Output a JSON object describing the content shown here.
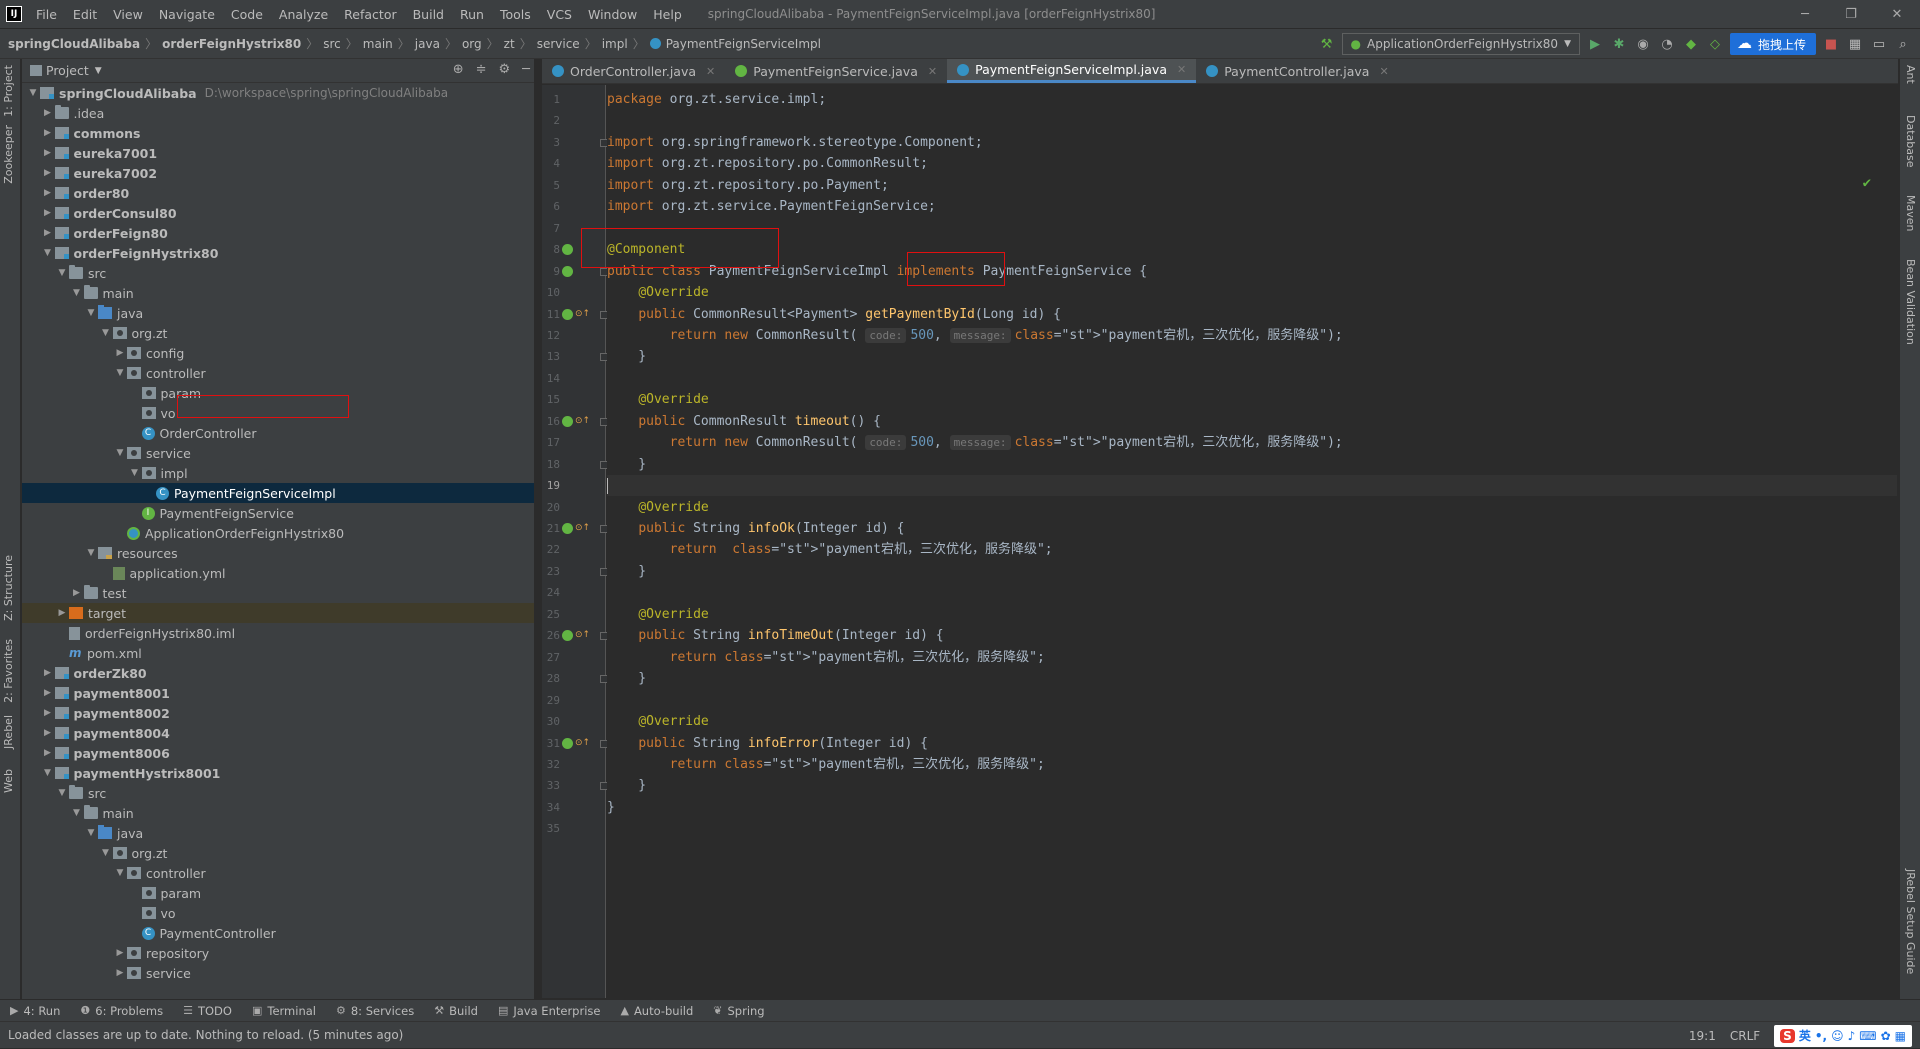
{
  "window": {
    "title": "springCloudAlibaba - PaymentFeignServiceImpl.java [orderFeignHystrix80]",
    "menu": [
      "File",
      "Edit",
      "View",
      "Navigate",
      "Code",
      "Analyze",
      "Refactor",
      "Build",
      "Run",
      "Tools",
      "VCS",
      "Window",
      "Help"
    ]
  },
  "breadcrumb": [
    "springCloudAlibaba",
    "orderFeignHystrix80",
    "src",
    "main",
    "java",
    "org",
    "zt",
    "service",
    "impl",
    "PaymentFeignServiceImpl"
  ],
  "toolbar": {
    "run_config": "ApplicationOrderFeignHystrix80",
    "upload_label": "拖拽上传"
  },
  "left_strip": {
    "project": "1: Project",
    "zookeeper": "Zookeeper",
    "structure": "Z: Structure",
    "favorites": "2: Favorites",
    "jrebel": "JRebel",
    "web": "Web"
  },
  "right_strip": {
    "ant": "Ant",
    "database": "Database",
    "maven": "Maven",
    "bean": "Bean Validation",
    "jrebel_guide": "JRebel Setup Guide"
  },
  "project_panel": {
    "title": "Project",
    "tree": [
      {
        "label": "springCloudAlibaba",
        "path": "D:\\workspace\\spring\\springCloudAlibaba",
        "icon": "mfolder",
        "depth": 0,
        "arrow": "v",
        "bold": true
      },
      {
        "label": ".idea",
        "icon": "folder",
        "depth": 1,
        "arrow": ">"
      },
      {
        "label": "commons",
        "icon": "mfolder",
        "depth": 1,
        "arrow": ">",
        "bold": true
      },
      {
        "label": "eureka7001",
        "icon": "mfolder",
        "depth": 1,
        "arrow": ">",
        "bold": true
      },
      {
        "label": "eureka7002",
        "icon": "mfolder",
        "depth": 1,
        "arrow": ">",
        "bold": true
      },
      {
        "label": "order80",
        "icon": "mfolder",
        "depth": 1,
        "arrow": ">",
        "bold": true
      },
      {
        "label": "orderConsul80",
        "icon": "mfolder",
        "depth": 1,
        "arrow": ">",
        "bold": true
      },
      {
        "label": "orderFeign80",
        "icon": "mfolder",
        "depth": 1,
        "arrow": ">",
        "bold": true
      },
      {
        "label": "orderFeignHystrix80",
        "icon": "mfolder",
        "depth": 1,
        "arrow": "v",
        "bold": true
      },
      {
        "label": "src",
        "icon": "folder",
        "depth": 2,
        "arrow": "v"
      },
      {
        "label": "main",
        "icon": "folder",
        "depth": 3,
        "arrow": "v"
      },
      {
        "label": "java",
        "icon": "src",
        "depth": 4,
        "arrow": "v"
      },
      {
        "label": "org.zt",
        "icon": "pkg",
        "depth": 5,
        "arrow": "v"
      },
      {
        "label": "config",
        "icon": "pkg",
        "depth": 6,
        "arrow": ">"
      },
      {
        "label": "controller",
        "icon": "pkg",
        "depth": 6,
        "arrow": "v"
      },
      {
        "label": "param",
        "icon": "pkg",
        "depth": 7,
        "arrow": ""
      },
      {
        "label": "vo",
        "icon": "pkg",
        "depth": 7,
        "arrow": ""
      },
      {
        "label": "OrderController",
        "icon": "class",
        "depth": 7,
        "arrow": ""
      },
      {
        "label": "service",
        "icon": "pkg",
        "depth": 6,
        "arrow": "v"
      },
      {
        "label": "impl",
        "icon": "pkg",
        "depth": 7,
        "arrow": "v"
      },
      {
        "label": "PaymentFeignServiceImpl",
        "icon": "class",
        "depth": 8,
        "arrow": "",
        "selected": true
      },
      {
        "label": "PaymentFeignService",
        "icon": "iface",
        "depth": 7,
        "arrow": ""
      },
      {
        "label": "ApplicationOrderFeignHystrix80",
        "icon": "boot",
        "depth": 6,
        "arrow": ""
      },
      {
        "label": "resources",
        "icon": "res",
        "depth": 4,
        "arrow": "v"
      },
      {
        "label": "application.yml",
        "icon": "yml",
        "depth": 5,
        "arrow": ""
      },
      {
        "label": "test",
        "icon": "folder",
        "depth": 3,
        "arrow": ">"
      },
      {
        "label": "target",
        "icon": "target",
        "depth": 2,
        "arrow": ">",
        "highlight": true
      },
      {
        "label": "orderFeignHystrix80.iml",
        "icon": "iml",
        "depth": 2,
        "arrow": ""
      },
      {
        "label": "pom.xml",
        "icon": "pom",
        "depth": 2,
        "arrow": ""
      },
      {
        "label": "orderZk80",
        "icon": "mfolder",
        "depth": 1,
        "arrow": ">",
        "bold": true
      },
      {
        "label": "payment8001",
        "icon": "mfolder",
        "depth": 1,
        "arrow": ">",
        "bold": true
      },
      {
        "label": "payment8002",
        "icon": "mfolder",
        "depth": 1,
        "arrow": ">",
        "bold": true
      },
      {
        "label": "payment8004",
        "icon": "mfolder",
        "depth": 1,
        "arrow": ">",
        "bold": true
      },
      {
        "label": "payment8006",
        "icon": "mfolder",
        "depth": 1,
        "arrow": ">",
        "bold": true
      },
      {
        "label": "paymentHystrix8001",
        "icon": "mfolder",
        "depth": 1,
        "arrow": "v",
        "bold": true
      },
      {
        "label": "src",
        "icon": "folder",
        "depth": 2,
        "arrow": "v"
      },
      {
        "label": "main",
        "icon": "folder",
        "depth": 3,
        "arrow": "v"
      },
      {
        "label": "java",
        "icon": "src",
        "depth": 4,
        "arrow": "v"
      },
      {
        "label": "org.zt",
        "icon": "pkg",
        "depth": 5,
        "arrow": "v"
      },
      {
        "label": "controller",
        "icon": "pkg",
        "depth": 6,
        "arrow": "v"
      },
      {
        "label": "param",
        "icon": "pkg",
        "depth": 7,
        "arrow": ""
      },
      {
        "label": "vo",
        "icon": "pkg",
        "depth": 7,
        "arrow": ""
      },
      {
        "label": "PaymentController",
        "icon": "class",
        "depth": 7,
        "arrow": ""
      },
      {
        "label": "repository",
        "icon": "pkg",
        "depth": 6,
        "arrow": ">"
      },
      {
        "label": "service",
        "icon": "pkg",
        "depth": 6,
        "arrow": ">"
      }
    ]
  },
  "editor_tabs": [
    {
      "label": "OrderController.java",
      "icon": "class"
    },
    {
      "label": "PaymentFeignService.java",
      "icon": "iface"
    },
    {
      "label": "PaymentFeignServiceImpl.java",
      "icon": "class",
      "active": true
    },
    {
      "label": "PaymentController.java",
      "icon": "class"
    }
  ],
  "code": {
    "line_count": 35,
    "current_line": 19,
    "lines": [
      "package org.zt.service.impl;",
      "",
      "import org.springframework.stereotype.Component;",
      "import org.zt.repository.po.CommonResult;",
      "import org.zt.repository.po.Payment;",
      "import org.zt.service.PaymentFeignService;",
      "",
      "@Component",
      "public class PaymentFeignServiceImpl implements PaymentFeignService {",
      "    @Override",
      "    public CommonResult<Payment> getPaymentById(Long id) {",
      "        return new CommonResult( code: 500, message: \"payment宕机，三次优化，服务降级\");",
      "    }",
      "",
      "    @Override",
      "    public CommonResult timeout() {",
      "        return new CommonResult( code: 500, message: \"payment宕机，三次优化，服务降级\");",
      "    }",
      "",
      "    @Override",
      "    public String infoOk(Integer id) {",
      "        return  \"payment宕机，三次优化，服务降级\";",
      "    }",
      "",
      "    @Override",
      "    public String infoTimeOut(Integer id) {",
      "        return \"payment宕机，三次优化，服务降级\";",
      "    }",
      "",
      "    @Override",
      "    public String infoError(Integer id) {",
      "        return \"payment宕机，三次优化，服务降级\";",
      "    }",
      "}",
      ""
    ]
  },
  "bottom_tools": [
    {
      "label": "4: Run",
      "icon": "▶"
    },
    {
      "label": "6: Problems",
      "icon": "❶"
    },
    {
      "label": "TODO",
      "icon": "☰"
    },
    {
      "label": "Terminal",
      "icon": "▣"
    },
    {
      "label": "8: Services",
      "icon": "⚙"
    },
    {
      "label": "Build",
      "icon": "⚒"
    },
    {
      "label": "Java Enterprise",
      "icon": "▤"
    },
    {
      "label": "Auto-build",
      "icon": "▲"
    },
    {
      "label": "Spring",
      "icon": "❦"
    }
  ],
  "status": {
    "message": "Loaded classes are up to date. Nothing to reload. (5 minutes ago)",
    "position": "19:1",
    "line_sep": "CRLF",
    "ime_label": "英"
  }
}
